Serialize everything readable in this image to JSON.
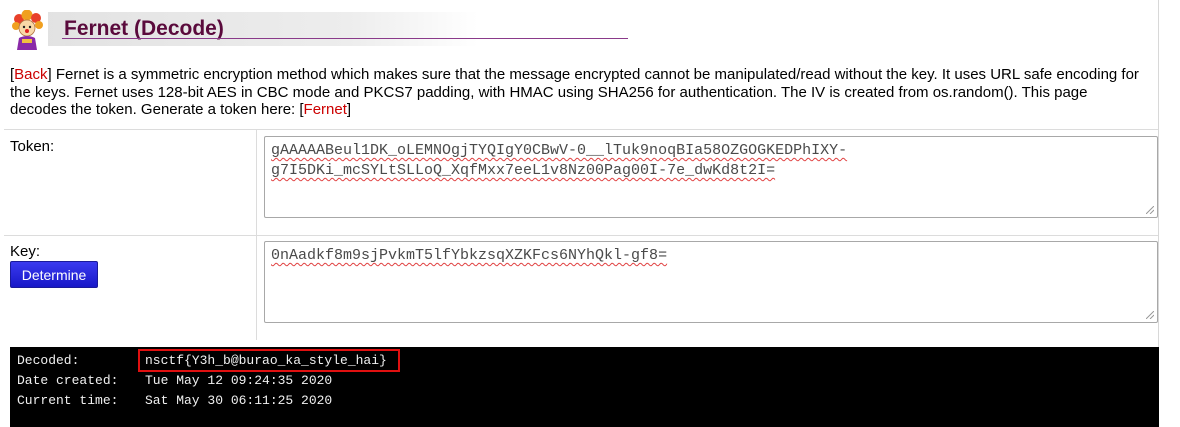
{
  "header": {
    "title": "Fernet (Decode)",
    "logo_icon": "cartoon-character-logo-icon"
  },
  "description": {
    "back_link": "Back",
    "text": " Fernet is a symmetric encryption method which makes sure that the message encrypted cannot be manipulated/read without the key. It uses URL safe encoding for the keys. Fernet uses 128-bit AES in CBC mode and PKCS7 padding, with HMAC using SHA256 for authentication. The IV is created from os.random(). This page decodes the token. Generate a token here: ",
    "generate_link": "Fernet"
  },
  "form": {
    "token_label": "Token:",
    "token_value": "gAAAAABeul1DK_oLEMNOgjTYQIgY0CBwV-0__lTuk9noqBIa58OZGOGKEDPhIXY-g7I5DKi_mcSYLtSLLoQ_XqfMxx7eeL1v8Nz00Pag00I-7e_dwKd8t2I=",
    "token_line1": "gAAAAABeul1DK_oLEMNOgjTYQIgY0CBwV-0__lTuk9noqBIa58OZGOGKEDPhIXY-",
    "token_line2": "g7I5DKi_mcSYLtSLLoQ_XqfMxx7eeL1v8Nz00Pag00I-7e_dwKd8t2I=",
    "key_label": "Key:",
    "key_value": "0nAadkf8m9sjPvkmT5lfYbkzsqXZKFcs6NYhQkl-gf8=",
    "determine_button": "Determine"
  },
  "output": {
    "decoded_label": "Decoded:",
    "decoded_value": "nsctf{Y3h_b@burao_ka_style_hai}",
    "date_created_label": "Date created:",
    "date_created_value": "Tue May 12 09:24:35 2020",
    "current_time_label": "Current time:",
    "current_time_value": "Sat May 30 06:11:25 2020"
  },
  "colors": {
    "title": "#5a0a3c",
    "link": "#cc0000",
    "button": "#2424d8",
    "terminal_bg": "#000000",
    "highlight": "#e01010"
  }
}
